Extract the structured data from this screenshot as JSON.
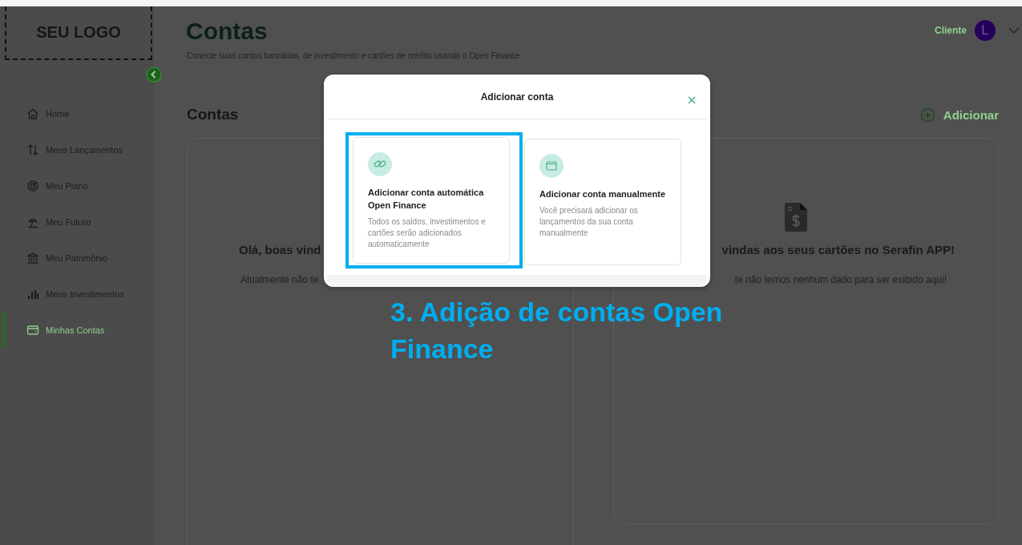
{
  "logo": {
    "text": "SEU LOGO"
  },
  "sidebar": {
    "items": [
      {
        "label": "Home",
        "kind": "home",
        "selected": false
      },
      {
        "label": "Meus Lançamentos",
        "kind": "arrows",
        "selected": false
      },
      {
        "label": "Meu Plano",
        "kind": "target",
        "selected": false
      },
      {
        "label": "Meu Futuro",
        "kind": "umbrella",
        "selected": false
      },
      {
        "label": "Meu Patrimônio",
        "kind": "bank",
        "selected": false
      },
      {
        "label": "Meus Investimentos",
        "kind": "bars",
        "selected": false
      },
      {
        "label": "Minhas Contas",
        "kind": "wallet",
        "selected": true
      }
    ]
  },
  "header": {
    "title": "Contas",
    "subtitle": "Conecte suas contas bancárias, de investimento e cartões de crédito usando o Open Finance",
    "user": {
      "role": "Cliente",
      "initial": "L"
    }
  },
  "section": {
    "title": "Contas",
    "add_button": "Adicionar"
  },
  "panels": [
    {
      "heading": "Olá, boas vind",
      "message": "Atualmente não te",
      "has_icon": false
    },
    {
      "heading": "vindas aos seus cartões no Serafin APP!",
      "message": "te não temos nenhum dado para ser exibido aqui!",
      "has_icon": true
    }
  ],
  "modal": {
    "title": "Adicionar conta",
    "options": [
      {
        "kind": "link",
        "title": "Adicionar conta automática Open Finance",
        "description": "Todos os saldos, investimentos e cartões serão adicionados automaticamente",
        "highlighted": true
      },
      {
        "kind": "wallet",
        "title": "Adicionar conta manualmente",
        "description": "Você precisará adicionar os lançamentos da sua conta manualmente",
        "highlighted": false
      }
    ]
  },
  "annotation": {
    "text": "3. Adição de contas Open Finance"
  }
}
